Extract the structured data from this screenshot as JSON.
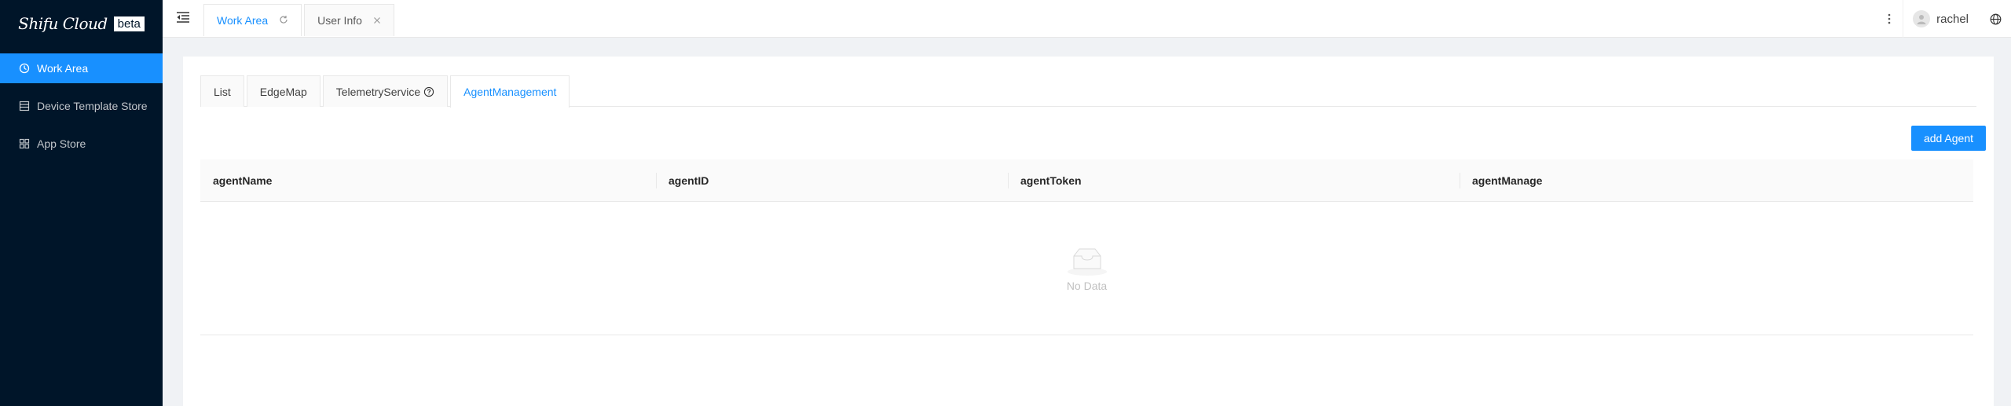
{
  "logo": {
    "text": "Shifu Cloud",
    "badge": "beta"
  },
  "sidebar": {
    "items": [
      {
        "label": "Work Area",
        "icon": "dashboard-icon",
        "active": true
      },
      {
        "label": "Device Template Store",
        "icon": "store-icon",
        "active": false
      },
      {
        "label": "App Store",
        "icon": "appstore-icon",
        "active": false
      }
    ]
  },
  "header": {
    "page_tabs": [
      {
        "label": "Work Area",
        "icon": "reload-icon",
        "active": true
      },
      {
        "label": "User Info",
        "icon": "close-icon",
        "active": false
      }
    ],
    "user": {
      "name": "rachel"
    }
  },
  "content": {
    "tabs": [
      {
        "label": "List",
        "active": false
      },
      {
        "label": "EdgeMap",
        "active": false
      },
      {
        "label": "TelemetryService",
        "icon": "question-circle-icon",
        "active": false
      },
      {
        "label": "AgentManagement",
        "active": true
      }
    ],
    "add_button": "add Agent",
    "table": {
      "columns": [
        "agentName",
        "agentID",
        "agentToken",
        "agentManage"
      ],
      "rows": [],
      "empty_text": "No Data"
    }
  },
  "colors": {
    "sidebar_bg": "#001529",
    "accent": "#1890ff",
    "page_bg": "#f0f2f5"
  }
}
